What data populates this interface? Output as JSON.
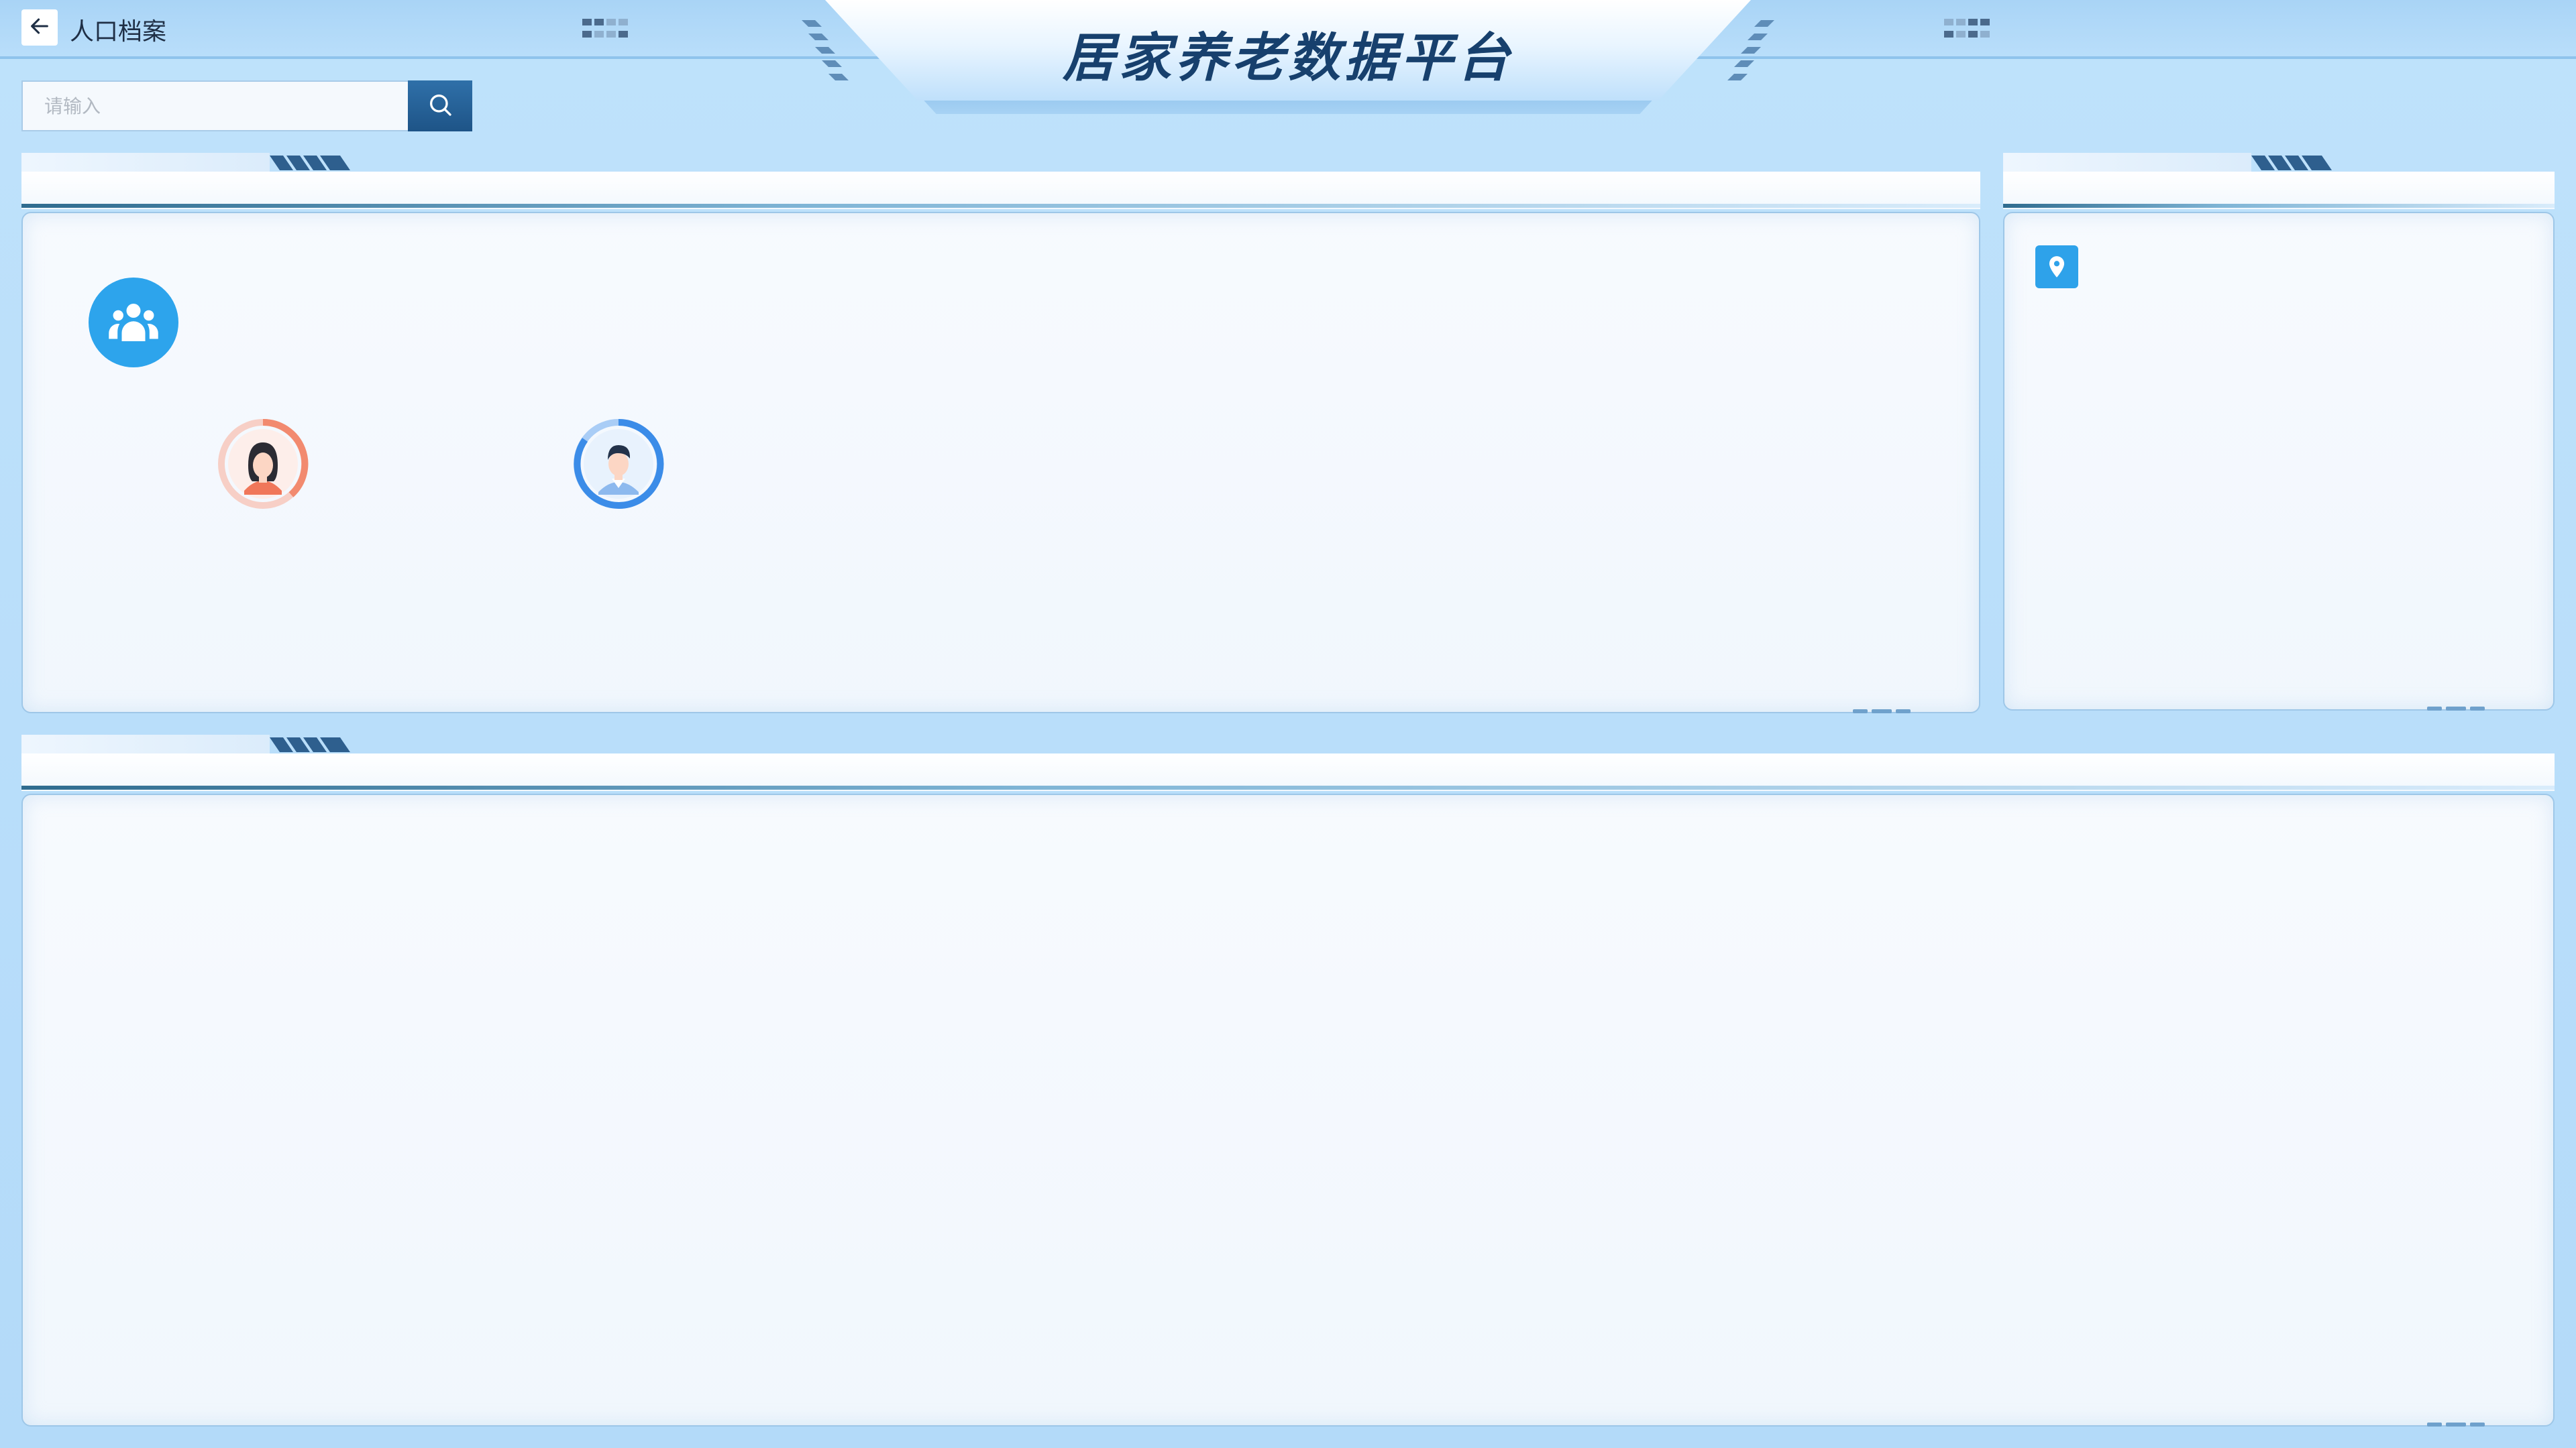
{
  "header": {
    "page_title": "人口档案",
    "main_title": "居家养老数据平台"
  },
  "search": {
    "placeholder": "请输入",
    "value": ""
  },
  "icons": {
    "back": "arrow-left-icon",
    "search": "search-icon",
    "population": "people-group-icon",
    "female": "female-avatar-icon",
    "male": "male-avatar-icon",
    "location": "map-pin-icon"
  },
  "colors": {
    "background": "#b6dcfa",
    "title_text": "#17406d",
    "accent_blue": "#2da4ec",
    "search_button": "#1e5487",
    "female_ring": "#f28a6f",
    "male_ring": "#3b8ce8"
  }
}
